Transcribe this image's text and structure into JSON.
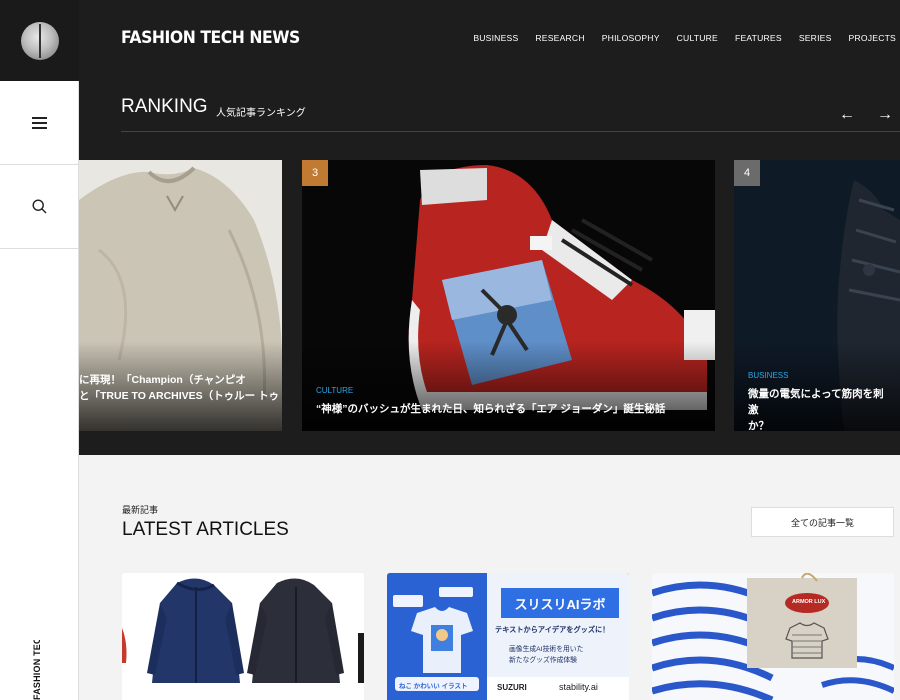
{
  "brand": "FASHION TECH NEWS",
  "nav": [
    "BUSINESS",
    "RESEARCH",
    "PHILOSOPHY",
    "CULTURE",
    "FEATURES",
    "SERIES",
    "PROJECTS"
  ],
  "ranking": {
    "title": "RANKING",
    "subtitle": "人気記事ランキング",
    "prev": "←",
    "next": "→",
    "cards": [
      {
        "title_line1": "に再現！「Champion（チャンピオ",
        "title_line2": "と「TRUE TO ARCHIVES（トゥルー トゥ"
      },
      {
        "rank": "3",
        "category": "CULTURE",
        "title": "“神様”のバッシュが生まれた日、知られざる「エア ジョーダン」誕生秘話"
      },
      {
        "rank": "4",
        "category": "BUSINESS",
        "title_line1": "微量の電気によって筋肉を刺激",
        "title_line2": "か？"
      }
    ]
  },
  "latest": {
    "subtitle": "最新記事",
    "title": "LATEST ARTICLES",
    "all_button": "全ての記事一覧",
    "card2": {
      "headline": "スリスリAIラボ",
      "sub": "テキストからアイデアをグッズに！",
      "line1": "画像生成AI技術を用いた",
      "line2": "新たなグッズ作成体験",
      "logo1": "SUZURI",
      "logo2": "stability.ai",
      "chip": "ねこ かわいい イラスト"
    },
    "card3": {
      "tag": "ARMOR LUX"
    }
  },
  "sidebar": {
    "vertical_text": "FASHION TECH NEWS"
  },
  "colors": {
    "bronze": "#c07a32",
    "grey_badge": "#6b6b6b",
    "category": "#2ba6e8"
  }
}
